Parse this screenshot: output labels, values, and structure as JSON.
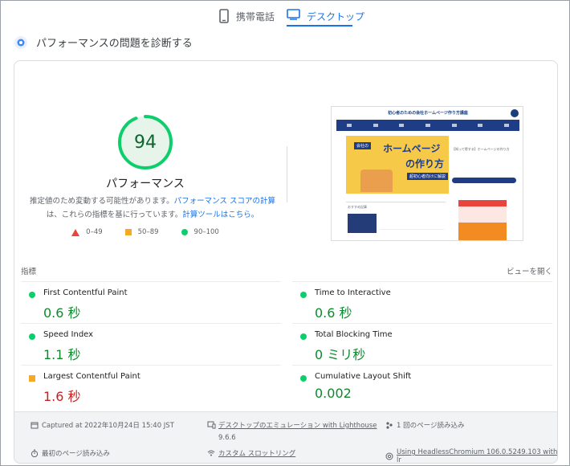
{
  "device_tabs": {
    "mobile_label": "携帯電話",
    "desktop_label": "デスクトップ"
  },
  "diagnose": {
    "title": "パフォーマンスの問題を診断する"
  },
  "score": {
    "value": "94",
    "value_fraction": 0.94,
    "label": "パフォーマンス",
    "color": "#0cce6b",
    "description_prefix": "推定値のため変動する可能性があります。",
    "link_score_calc": "パフォーマンス スコアの計算",
    "description_mid": "は、これらの指標を基に行っています。",
    "link_calculator": "計算ツールはこちら。"
  },
  "legend": [
    {
      "range": "0–49",
      "icon": "red-triangle-icon",
      "color": "#e8453c"
    },
    {
      "range": "50–89",
      "icon": "orange-square-icon",
      "color": "#f9a825"
    },
    {
      "range": "90–100",
      "icon": "green-circle-icon",
      "color": "#0cce6b"
    }
  ],
  "thumbnail": {
    "site_title": "初心者のための会社ホームページ作り方講座",
    "banner_tag": "会社の",
    "banner_title_1": "ホームページ",
    "banner_title_2": "の作り方",
    "banner_sub": "超初心者向けに解説",
    "side_text": "【知って得する】ホームページの作り方",
    "lower_label": "おすすめ記事"
  },
  "metrics": {
    "header": "指標",
    "view_toggle": "ビューを開く",
    "items": [
      {
        "name": "First Contentful Paint",
        "value": "0.6 秒",
        "status": "good"
      },
      {
        "name": "Time to Interactive",
        "value": "0.6 秒",
        "status": "good"
      },
      {
        "name": "Speed Index",
        "value": "1.1 秒",
        "status": "good"
      },
      {
        "name": "Total Blocking Time",
        "value": "0 ミリ秒",
        "status": "good"
      },
      {
        "name": "Largest Contentful Paint",
        "value": "1.6 秒",
        "status": "average"
      },
      {
        "name": "Cumulative Layout Shift",
        "value": "0.002",
        "status": "good"
      }
    ]
  },
  "footer": {
    "captured": "Captured at 2022年10月24日 15:40 JST",
    "emulation": "デスクトップのエミュレーション with Lighthouse",
    "lighthouse_version": "9.6.6",
    "page_loads": "1 回のページ読み込み",
    "initial_load": "最初のページ読み込み",
    "throttling": "カスタム スロットリング",
    "browser": "Using HeadlessChromium 106.0.5249.103 with lr"
  },
  "colors": {
    "good": "#0d8a2f",
    "average": "#c5221f",
    "accent": "#1a73e8"
  }
}
